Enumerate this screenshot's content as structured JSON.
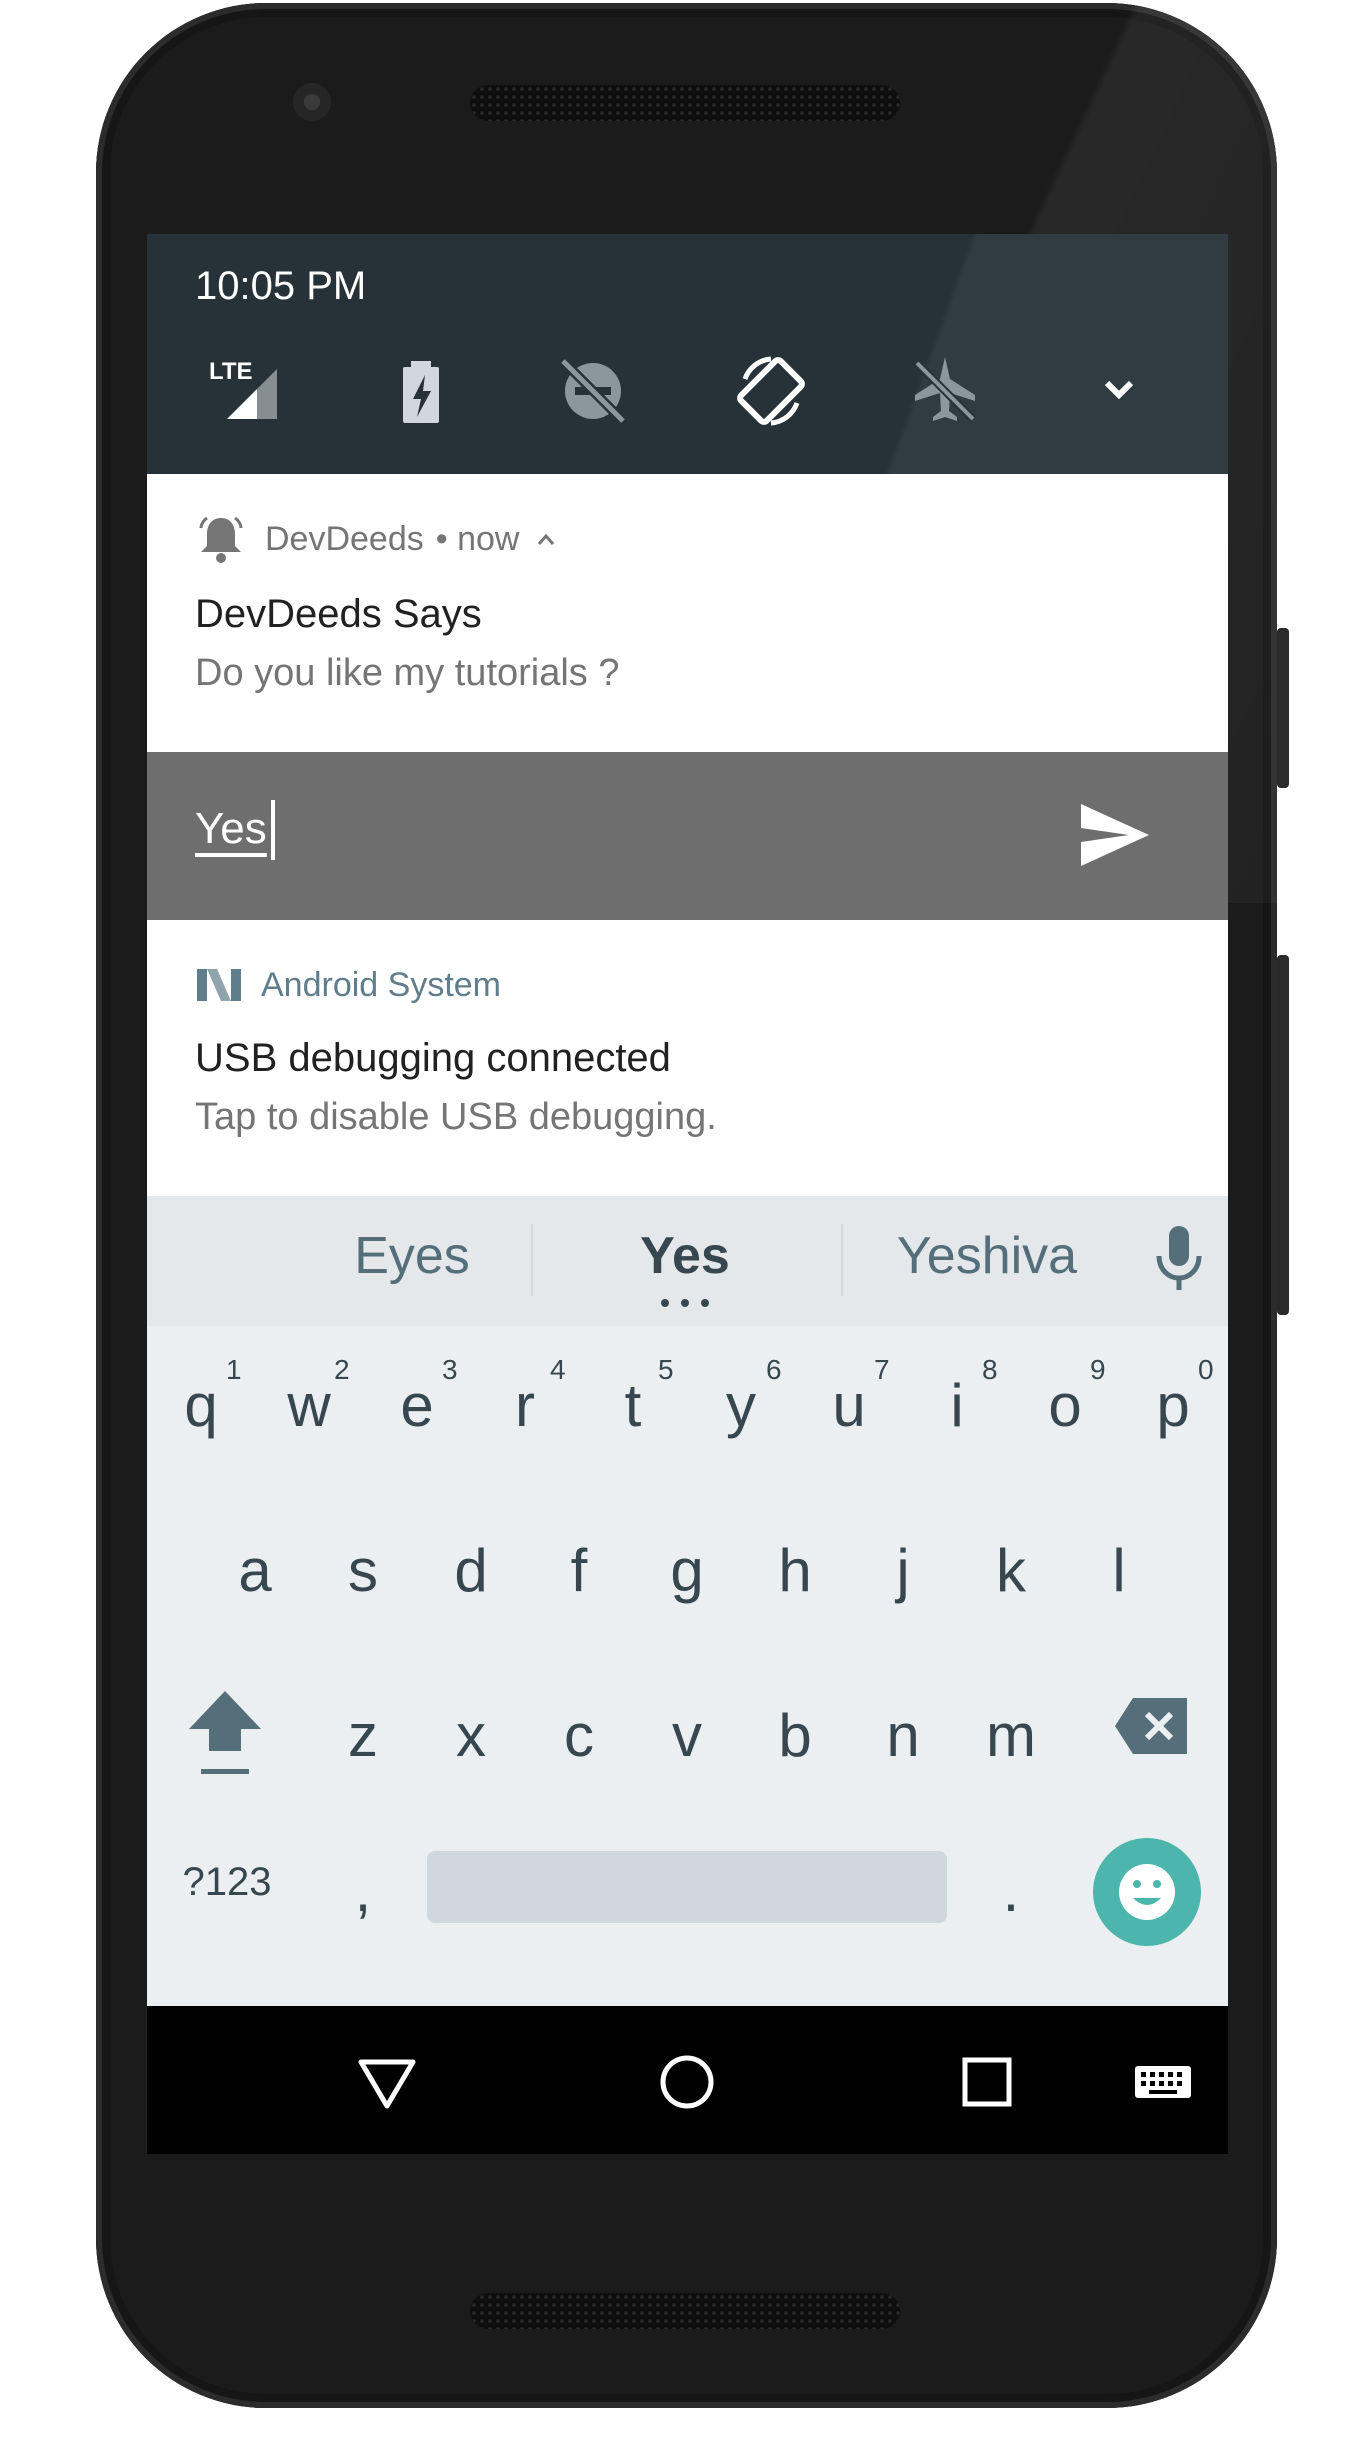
{
  "status_bar": {
    "time": "10:05 PM",
    "network": "LTE"
  },
  "quick_settings": [
    {
      "icon": "lte-signal-icon",
      "state": "on"
    },
    {
      "icon": "battery-saver-icon",
      "state": "on"
    },
    {
      "icon": "do-not-disturb-off-icon",
      "state": "off"
    },
    {
      "icon": "auto-rotate-icon",
      "state": "on"
    },
    {
      "icon": "airplane-mode-icon",
      "state": "off"
    },
    {
      "icon": "expand-chevron-icon",
      "state": "n/a"
    }
  ],
  "notifications": [
    {
      "app": "DevDeeds",
      "meta": "• now",
      "title": "DevDeeds Says",
      "text": "Do you like my tutorials ?",
      "icon": "bell-icon",
      "reply": {
        "value": "Yes",
        "send_icon": "send-icon"
      }
    },
    {
      "app": "Android System",
      "title": "USB debugging connected",
      "text": "Tap to disable USB debugging.",
      "icon": "android-n-icon"
    }
  ],
  "keyboard": {
    "suggestions": [
      "Eyes",
      "Yes",
      "Yeshiva"
    ],
    "row1": [
      "q",
      "w",
      "e",
      "r",
      "t",
      "y",
      "u",
      "i",
      "o",
      "p"
    ],
    "row1_hints": [
      "1",
      "2",
      "3",
      "4",
      "5",
      "6",
      "7",
      "8",
      "9",
      "0"
    ],
    "row2": [
      "a",
      "s",
      "d",
      "f",
      "g",
      "h",
      "j",
      "k",
      "l"
    ],
    "row3": [
      "z",
      "x",
      "c",
      "v",
      "b",
      "n",
      "m"
    ],
    "symbols_label": "?123",
    "comma": ",",
    "period": "."
  },
  "colors": {
    "qs_background": "#263238",
    "reply_background": "#6e6e6e",
    "emoji_accent": "#4db6ac",
    "app_name_blue": "#607d8b"
  }
}
